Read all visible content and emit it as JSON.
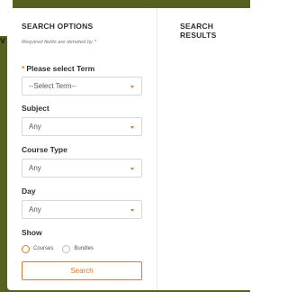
{
  "background": {
    "glyph": "v"
  },
  "search_options": {
    "title": "SEARCH OPTIONS",
    "required_note": "Required fields are denoted by *",
    "term": {
      "required_mark": "*",
      "label": "Please select Term",
      "value": "--Select Term--"
    },
    "subject": {
      "label": "Subject",
      "value": "Any"
    },
    "course_type": {
      "label": "Course Type",
      "value": "Any"
    },
    "day": {
      "label": "Day",
      "value": "Any"
    },
    "show": {
      "label": "Show",
      "options": [
        "Courses",
        "Bundles"
      ]
    },
    "search_button": "Search"
  },
  "search_results": {
    "title": "SEARCH RESULTS"
  },
  "colors": {
    "accent": "#e0792b",
    "frame": "#54611f"
  }
}
